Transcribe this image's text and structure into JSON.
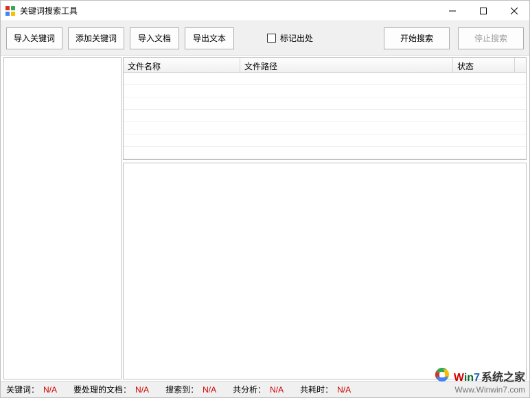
{
  "window": {
    "title": "关键词搜索工具"
  },
  "toolbar": {
    "import_keywords": "导入关键词",
    "add_keywords": "添加关键词",
    "import_docs": "导入文档",
    "export_text": "导出文本",
    "mark_source_label": "标记出处",
    "start_search": "开始搜索",
    "stop_search": "停止搜索"
  },
  "listview": {
    "columns": {
      "filename": "文件名称",
      "filepath": "文件路径",
      "status": "状态"
    }
  },
  "status": {
    "keywords_label": "关键词：",
    "keywords_value": "N/A",
    "docs_label": "要处理的文档：",
    "docs_value": "N/A",
    "found_label": "搜索到：",
    "found_value": "N/A",
    "analyzed_label": "共分析：",
    "analyzed_value": "N/A",
    "elapsed_label": "共耗时：",
    "elapsed_value": "N/A"
  },
  "watermark": {
    "brand_w": "W",
    "brand_in": "in",
    "brand_7": "7",
    "brand_rest": "系统之家",
    "url": "Www.Winwin7.com"
  }
}
